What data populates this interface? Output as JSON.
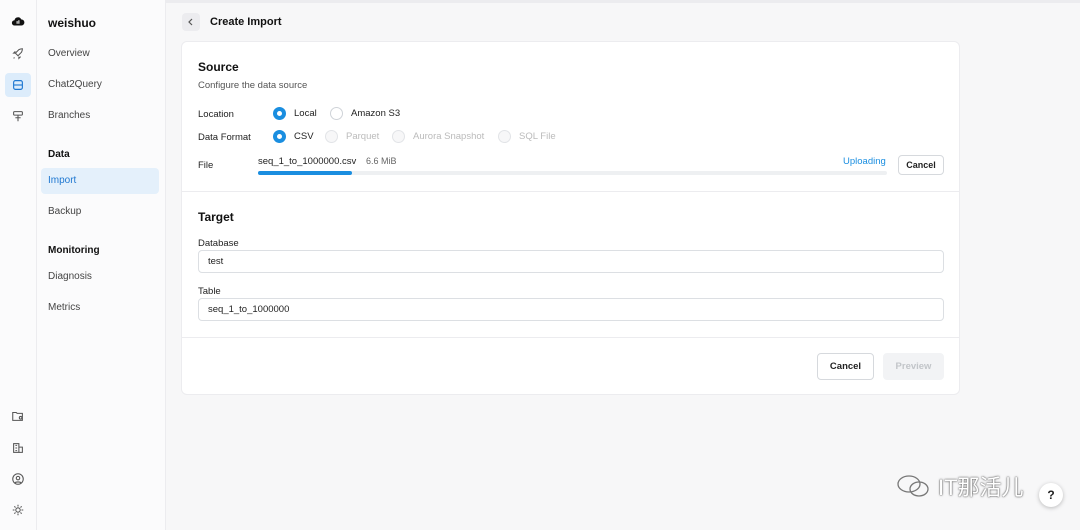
{
  "rail": {
    "icons": [
      "cloud-logo-icon",
      "rocket-icon",
      "database-icon",
      "signpost-icon",
      "folder-settings-icon",
      "building-icon",
      "user-circle-icon",
      "sun-icon"
    ]
  },
  "nav": {
    "project": "weishuo",
    "items": [
      "Overview",
      "Chat2Query",
      "Branches"
    ],
    "data_section": "Data",
    "data_items": [
      "Import",
      "Backup"
    ],
    "monitoring_section": "Monitoring",
    "monitoring_items": [
      "Diagnosis",
      "Metrics"
    ]
  },
  "header": {
    "title": "Create Import"
  },
  "source": {
    "title": "Source",
    "description": "Configure the data source",
    "location_label": "Location",
    "location_options": [
      "Local",
      "Amazon S3"
    ],
    "location_selected": "Local",
    "format_label": "Data Format",
    "format_options": [
      "CSV",
      "Parquet",
      "Aurora Snapshot",
      "SQL File"
    ],
    "format_selected": "CSV",
    "file_label": "File",
    "file_name": "seq_1_to_1000000.csv",
    "file_size": "6.6 MiB",
    "upload_progress": 0.15,
    "upload_status": "Uploading",
    "cancel_upload_label": "Cancel"
  },
  "target": {
    "title": "Target",
    "database_label": "Database",
    "database_value": "test",
    "table_label": "Table",
    "table_value": "seq_1_to_1000000"
  },
  "footer": {
    "cancel_label": "Cancel",
    "preview_label": "Preview"
  },
  "watermark": {
    "text": "IT那活儿"
  },
  "help": {
    "label": "?"
  },
  "colors": {
    "accent": "#1a8ee0",
    "active_nav_bg": "#e4f0fb"
  }
}
